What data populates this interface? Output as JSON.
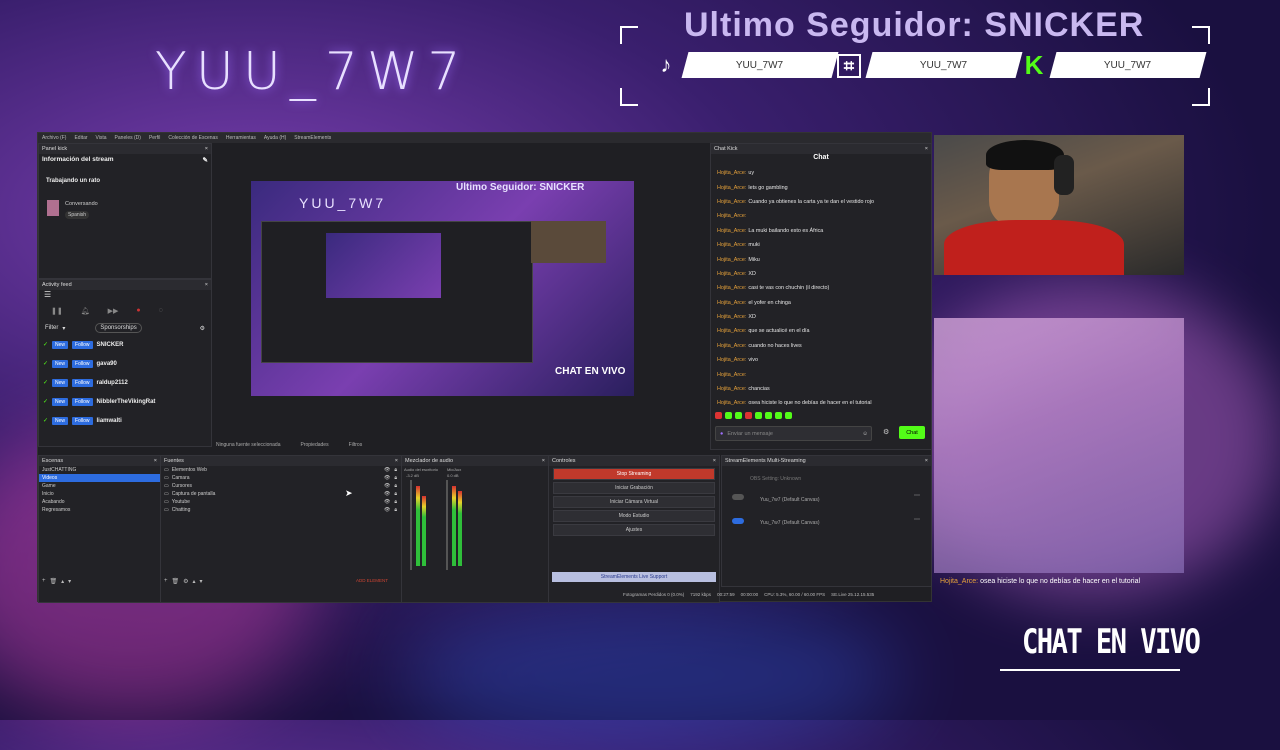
{
  "overlay": {
    "streamer_name": "YUU_7W7",
    "last_follower": "Ultimo Seguidor: SNICKER",
    "socials": [
      {
        "icon": "tiktok-icon",
        "handle": "YUU_7W7"
      },
      {
        "icon": "twitch-icon",
        "handle": "YUU_7W7"
      },
      {
        "icon": "kick-icon",
        "handle": "YUU_7W7"
      }
    ],
    "chat_label": "CHAT EN VIVO",
    "chat_popup_user": "Hojita_Arce:",
    "chat_popup_msg": "osea hiciste lo que no debías de hacer en el tutorial"
  },
  "obs": {
    "menu": [
      "Archivo (F)",
      "Editar",
      "Vista",
      "Paneles (D)",
      "Perfil",
      "Colección de Escenas",
      "Herramientas",
      "Ayuda (H)",
      "StreamElements"
    ],
    "panel_kick": {
      "title": "Panel kick",
      "section": "Información del stream",
      "stream_title": "Trabajando un rato",
      "category": "Conversando",
      "language": "Spanish"
    },
    "activity_feed": {
      "title": "Activity feed",
      "filter": "Filter",
      "sponsorships": "Sponsorships",
      "items": [
        {
          "tag1": "New",
          "tag2": "Follow",
          "name": "SNICKER"
        },
        {
          "tag1": "New",
          "tag2": "Follow",
          "name": "gava90"
        },
        {
          "tag1": "New",
          "tag2": "Follow",
          "name": "raldup2112"
        },
        {
          "tag1": "New",
          "tag2": "Follow",
          "name": "NibblerTheVikingRat"
        },
        {
          "tag1": "New",
          "tag2": "Follow",
          "name": "liamwalti"
        }
      ]
    },
    "preview_bar": {
      "no_source": "Ninguna fuente seleccionada",
      "properties": "Propiedades",
      "filters": "Filtros"
    },
    "chat": {
      "window_title": "Chat Kick",
      "header": "Chat",
      "lines": [
        {
          "user": "Hojita_Arce:",
          "msg": "uy"
        },
        {
          "user": "Hojita_Arce:",
          "msg": "lets go gambling"
        },
        {
          "user": "Hojita_Arce:",
          "msg": "Cuando ya obtienes la carta ya te dan el vestido rojo"
        },
        {
          "user": "Hojita_Arce:",
          "msg": ""
        },
        {
          "user": "Hojita_Arce:",
          "msg": "La muki bailando esto es África"
        },
        {
          "user": "Hojita_Arce:",
          "msg": "muki"
        },
        {
          "user": "Hojita_Arce:",
          "msg": "Miku"
        },
        {
          "user": "Hojita_Arce:",
          "msg": "XD"
        },
        {
          "user": "Hojita_Arce:",
          "msg": "casi te vas con chuchin (il directo)"
        },
        {
          "user": "Hojita_Arce:",
          "msg": "el yofer en chinga"
        },
        {
          "user": "Hojita_Arce:",
          "msg": "XD"
        },
        {
          "user": "Hojita_Arce:",
          "msg": "que se actualicé en el día"
        },
        {
          "user": "Hojita_Arce:",
          "msg": "cuando no haces lives"
        },
        {
          "user": "Hojita_Arce:",
          "msg": "vivo"
        },
        {
          "user": "Hojita_Arce:",
          "msg": ""
        },
        {
          "user": "Hojita_Arce:",
          "msg": "chancias"
        },
        {
          "user": "Hojita_Arce:",
          "msg": "osea hiciste lo que no debías de hacer en el tutorial"
        }
      ],
      "input_placeholder": "Enviar un mensaje",
      "send_label": "Chat"
    },
    "scenes": {
      "title": "Escenas",
      "items": [
        "JustCHATTING",
        "Videos",
        "Game",
        "Inicio",
        "Acabando",
        "Regresamos"
      ],
      "selected": 1
    },
    "sources": {
      "title": "Fuentes",
      "items": [
        "Elementos Web",
        "Camara",
        "Cursores",
        "Captura de pantalla",
        "Youtube",
        "Chatting"
      ],
      "add_element": "ADD ELEMENT"
    },
    "mixer": {
      "title": "Mezclador de audio",
      "ch1": "Audio del escritorio",
      "ch2": "Mic/Aux",
      "db1": "-3.2 dB",
      "db2": "0.0 dB"
    },
    "controls": {
      "title": "Controles",
      "stop_streaming": "Stop Streaming",
      "start_recording": "Iniciar Grabación",
      "start_virtual_cam": "Iniciar Cámara Virtual",
      "studio_mode": "Modo Estudio",
      "settings": "Ajustes",
      "live_support": "StreamElements Live Support"
    },
    "multistream": {
      "title": "StreamElements Multi-Streaming",
      "status": "OBS Setting: Unknown",
      "outputs": [
        "Yuu_7w7 (Default Canvas)",
        "Yuu_7w7 (Default Canvas)"
      ]
    },
    "statusbar": {
      "dropped": "Fotogramas Perdidos 0 (0.0%)",
      "kbps": "7192 kbps",
      "time": "00:27:59",
      "rec_time": "00:00:00",
      "cpu": "CPU: 5.3%, 60.00 / 60.00 FPS",
      "live": "SE.Live 25.12.15.535"
    }
  },
  "preview_content": {
    "mini_follower": "Ultimo Seguidor: SNICKER",
    "mini_name": "YUU_7W7",
    "mini_chat": "CHAT EN VIVO"
  },
  "colors": {
    "accent_green": "#53fc18",
    "stop_red": "#c0392b",
    "chat_user": "#e7a23a",
    "selected_scene": "#2d6cdf"
  }
}
